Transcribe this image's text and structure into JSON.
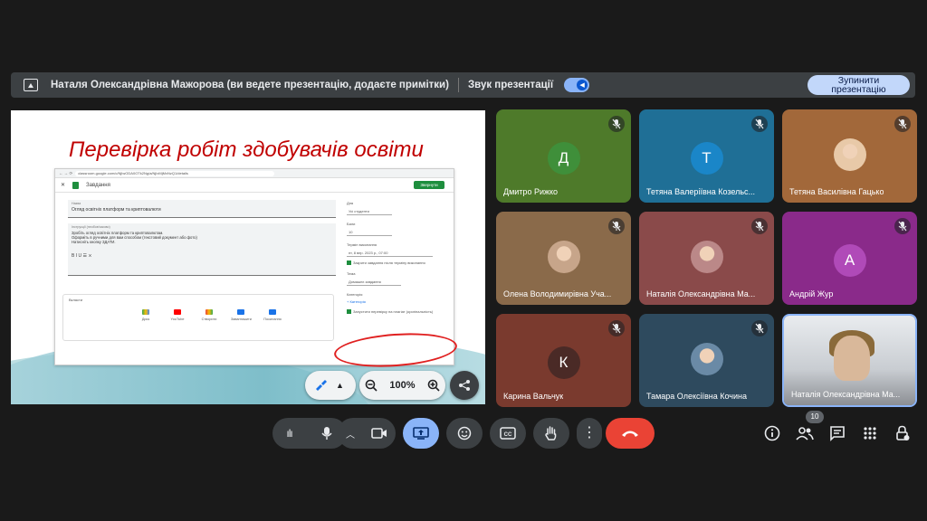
{
  "banner": {
    "presenter_text": "Наталя Олександрівна Мажорова (ви ведете презентацію, додаєте примітки)",
    "audio_label": "Звук презентації",
    "stop_button": "Зупинити презентацію",
    "audio_enabled": true
  },
  "slide": {
    "title": "Перевірка робіт здобувачів освіти",
    "embedded": {
      "url": "classroom.google.com/c/NjIwODA0OTk2Ng/a/NjIxMjMxNzQ1/details",
      "dialog_title": "Завдання",
      "assign_button": "Звернути",
      "topic_label": "Назва",
      "topic_value": "Огляд освітніх платформ та криптовалюти",
      "instructions_label": "Інструкції (необов'язково)",
      "instructions": [
        "Зробіть огляд освітніх платформ та криптовалютам.",
        "Оформіть в ручними для вам способом (текстовий документ або фото)",
        "Натисніть кнопку ЗДАТИ."
      ],
      "attach_label": "Вкласти",
      "attach_items": [
        "Диск",
        "YouTube",
        "Створити",
        "Завантажити",
        "Посилання"
      ],
      "right_labels": [
        "Для",
        "Бали",
        "Термін виконання",
        "Тема",
        "Категорія"
      ],
      "right_values": [
        "Усі студенти",
        "10",
        "пт, 8 вер. 2023 р., 07:00",
        "Закрити завдання після терміну виконання",
        "Домашнє завдання"
      ],
      "category_link": "+ Категорія",
      "checkbox_text": "Запустити перевірку на плагіат (оригінальність)"
    },
    "zoom": "100%"
  },
  "participants": [
    {
      "name": "Дмитро Рижко",
      "initial": "Д",
      "bg": "#4e7a2a",
      "avatar_color": "#3f8f3a",
      "muted": true
    },
    {
      "name": "Тетяна Валеріївна Козельс...",
      "initial": "Т",
      "bg": "#1f6f96",
      "avatar_color": "#1a86c8",
      "muted": true
    },
    {
      "name": "Тетяна Василівна Гацько",
      "initial": "",
      "bg": "#a2683a",
      "avatar_color": "#e8c9a8",
      "muted": true
    },
    {
      "name": "Олена Володимирівна Уча...",
      "initial": "",
      "bg": "#8a6a4a",
      "avatar_color": "#c7a58a",
      "muted": true
    },
    {
      "name": "Наталія Олександрівна Ма...",
      "initial": "",
      "bg": "#8a4a4a",
      "avatar_color": "#b88",
      "muted": true
    },
    {
      "name": "Андрій Жур",
      "initial": "А",
      "bg": "#8a2a8a",
      "avatar_color": "#b04ab8",
      "muted": true
    },
    {
      "name": "Карина Вальчук",
      "initial": "К",
      "bg": "#7a3a2e",
      "avatar_color": "#4a2a26",
      "muted": true
    },
    {
      "name": "Тамара Олексіївна Кочина",
      "initial": "",
      "bg": "#2e4a5e",
      "avatar_color": "#6a8aa6",
      "muted": true
    },
    {
      "name": "Наталія Олександрівна Ма...",
      "initial": "",
      "bg": "#4a4d52",
      "avatar_color": "#cca",
      "muted": false
    }
  ],
  "toolbar": {
    "participants_count": "10",
    "colors": {
      "end_call": "#ea4335",
      "present_active": "#8ab4f8",
      "control": "#3c4043"
    }
  },
  "icons": [
    "present-icon",
    "mic-off-icon",
    "chevron-up-icon",
    "camera-icon",
    "present-screen-icon",
    "emoji-icon",
    "captions-icon",
    "hand-icon",
    "more-icon",
    "end-call-icon",
    "info-icon",
    "people-icon",
    "chat-icon",
    "apps-icon",
    "lock-icon",
    "zoom-out-icon",
    "zoom-in-icon",
    "share-icon",
    "pen-icon"
  ]
}
